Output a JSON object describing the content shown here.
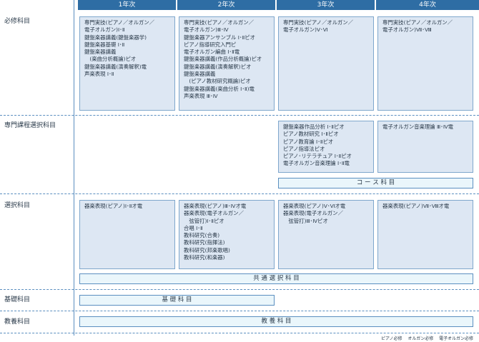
{
  "years": [
    "1年次",
    "2年次",
    "3年次",
    "4年次"
  ],
  "rows": {
    "required": "必修科目",
    "specialized_elective": "専門課程選択科目",
    "elective": "選択科目",
    "foundation": "基礎科目",
    "liberal_arts": "教養科目"
  },
  "required_boxes": [
    "専門実技(ピアノ／オルガン／\n電子オルガン)Ⅰ･Ⅱ\n鍵盤楽器講義(鍵盤楽器学)\n鍵盤楽器基礎 Ⅰ･Ⅱ\n鍵盤楽器講義\n　(楽曲分析概論)ピオ\n鍵盤楽器講義(演奏解釈)電\n声楽表現 Ⅰ･Ⅱ",
    "専門実技(ピアノ／オルガン／\n電子オルガン)Ⅲ･Ⅳ\n鍵盤楽器アンサンブル Ⅰ･Ⅱピオ\nピアノ指導研究入門ピ\n電子オルガン編曲 Ⅰ･Ⅱ電\n鍵盤楽器講義(作品分析概論)ピオ\n鍵盤楽器講義(演奏解釈)ピオ\n鍵盤楽器講義\n　(ピアノ教材研究概論)ピオ\n鍵盤楽器講義(楽曲分析 Ⅰ･Ⅱ)電\n声楽表現 Ⅲ･Ⅳ",
    "専門実技(ピアノ／オルガン／\n電子オルガン)Ⅴ･Ⅵ",
    "専門実技(ピアノ／オルガン／\n電子オルガン)Ⅶ･Ⅷ"
  ],
  "specialized_boxes": [
    "鍵盤楽器作品分析 Ⅰ･Ⅱピオ\nピアノ教材研究 Ⅰ･Ⅱピオ\nピアノ教育論 Ⅰ･Ⅱピオ\nピアノ指導法ピオ\nピアノ･リテラチュア Ⅰ･Ⅱピオ\n電子オルガン音楽理論 Ⅰ･Ⅱ電",
    "電子オルガン音楽理論 Ⅲ･Ⅳ電"
  ],
  "elective_boxes": [
    "器楽表現(ピアノ)Ⅰ･Ⅱオ電",
    "器楽表現(ピアノ)Ⅲ･Ⅳオ電\n器楽表現(電子オルガン／\n　弦管打)Ⅰ･Ⅱピオ\n合唱 Ⅰ･Ⅱ\n教科研究(合奏)\n教科研究(指揮法)\n教科研究(邦楽歌唱)\n教科研究(和楽器)",
    "器楽表現(ピアノ)Ⅴ･Ⅵオ電\n器楽表現(電子オルガン／\n　弦管打)Ⅲ･Ⅳピオ",
    "器楽表現(ピアノ)Ⅶ･Ⅷオ電"
  ],
  "bands": {
    "course": "コ ー ス 科 目",
    "common": "共 通 選 択 科 目",
    "foundation": "基 礎 科 目",
    "liberal_arts": "教 養 科 目"
  },
  "legend": [
    "ピアノ必修",
    "オルガン必修",
    "電子オルガン必修"
  ],
  "colors": {
    "header": "#2e6da4",
    "box": "#dde7f3",
    "band": "#eaf6fb",
    "line": "#5b8fc0"
  }
}
